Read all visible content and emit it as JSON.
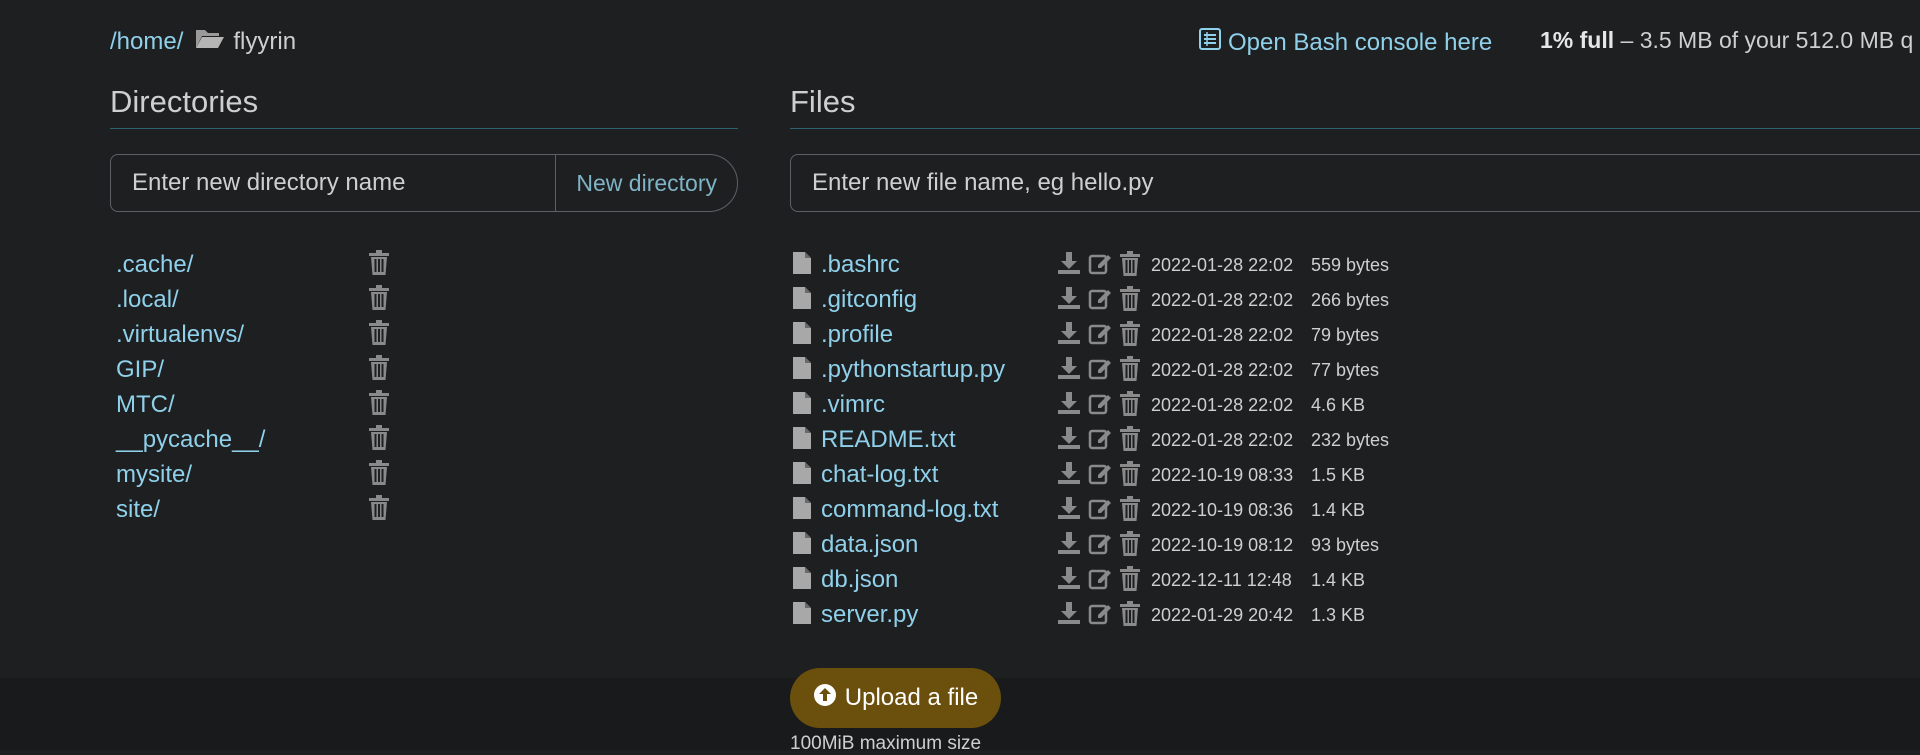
{
  "breadcrumb": {
    "home": "/home/",
    "current": "flyyrin",
    "folder_icon": "folder-open-icon"
  },
  "bash_console": {
    "label": "Open Bash console here",
    "icon": "console-list-icon"
  },
  "quota": {
    "percent": "1% full",
    "detail": " – 3.5 MB of your 512.0 MB q"
  },
  "directories": {
    "title": "Directories",
    "input_placeholder": "Enter new directory name",
    "new_button": "New directory",
    "items": [
      ".cache/",
      ".local/",
      ".virtualenvs/",
      "GIP/",
      "MTC/",
      "__pycache__/",
      "mysite/",
      "site/"
    ]
  },
  "files": {
    "title": "Files",
    "input_placeholder": "Enter new file name, eg hello.py",
    "items": [
      {
        "name": ".bashrc",
        "modified": "2022-01-28 22:02",
        "size": "559 bytes"
      },
      {
        "name": ".gitconfig",
        "modified": "2022-01-28 22:02",
        "size": "266 bytes"
      },
      {
        "name": ".profile",
        "modified": "2022-01-28 22:02",
        "size": "79 bytes"
      },
      {
        "name": ".pythonstartup.py",
        "modified": "2022-01-28 22:02",
        "size": "77 bytes"
      },
      {
        "name": ".vimrc",
        "modified": "2022-01-28 22:02",
        "size": "4.6 KB"
      },
      {
        "name": "README.txt",
        "modified": "2022-01-28 22:02",
        "size": "232 bytes"
      },
      {
        "name": "chat-log.txt",
        "modified": "2022-10-19 08:33",
        "size": "1.5 KB"
      },
      {
        "name": "command-log.txt",
        "modified": "2022-10-19 08:36",
        "size": "1.4 KB"
      },
      {
        "name": "data.json",
        "modified": "2022-10-19 08:12",
        "size": "93 bytes"
      },
      {
        "name": "db.json",
        "modified": "2022-12-11 12:48",
        "size": "1.4 KB"
      },
      {
        "name": "server.py",
        "modified": "2022-01-29 20:42",
        "size": "1.3 KB"
      }
    ]
  },
  "upload": {
    "label": "Upload a file",
    "note": "100MiB maximum size"
  },
  "colors": {
    "background": "#1e1f21",
    "link": "#8fd0ea",
    "accent_rule": "#2f6170",
    "upload_button": "#6b4f0c"
  }
}
